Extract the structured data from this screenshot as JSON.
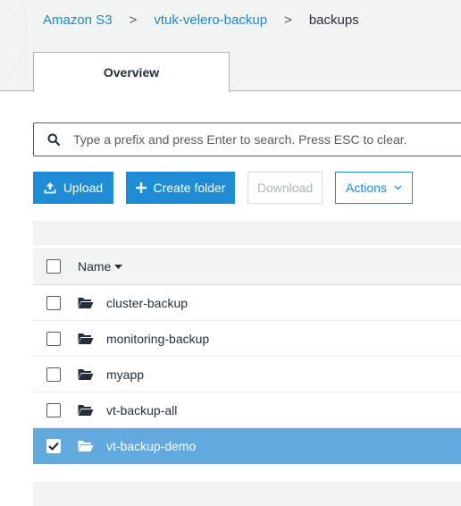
{
  "breadcrumb": {
    "items": [
      {
        "label": "Amazon S3"
      },
      {
        "label": "vtuk-velero-backup"
      },
      {
        "label": "backups"
      }
    ],
    "separator": ">"
  },
  "tabs": [
    {
      "label": "Overview",
      "active": true
    }
  ],
  "search": {
    "value": "",
    "placeholder": "Type a prefix and press Enter to search. Press ESC to clear.",
    "icon": "search-icon"
  },
  "toolbar": {
    "upload_label": "Upload",
    "upload_icon": "upload-icon",
    "create_folder_label": "Create folder",
    "create_folder_icon": "plus-icon",
    "download_label": "Download",
    "download_enabled": false,
    "actions_label": "Actions",
    "actions_icon": "chevron-down-icon"
  },
  "table": {
    "column_name": "Name",
    "sort": "descending",
    "rows": [
      {
        "name": "cluster-backup",
        "selected": false
      },
      {
        "name": "monitoring-backup",
        "selected": false
      },
      {
        "name": "myapp",
        "selected": false
      },
      {
        "name": "vt-backup-all",
        "selected": false
      },
      {
        "name": "vt-backup-demo",
        "selected": true
      }
    ]
  },
  "colors": {
    "primary": "#1f8dd6",
    "selected_row": "#62a9de",
    "link": "#1e88c6",
    "text": "#232f3e"
  }
}
